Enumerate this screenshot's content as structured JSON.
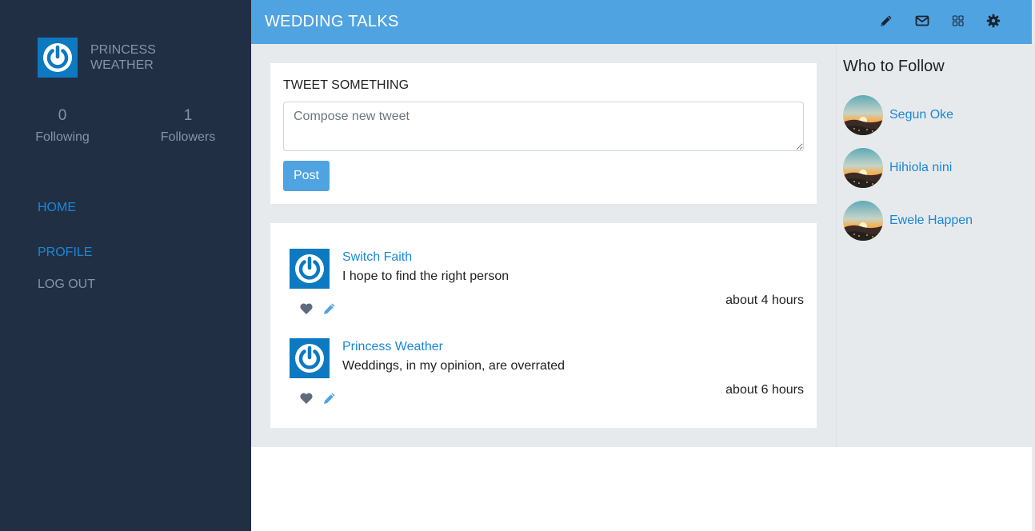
{
  "sidebar": {
    "profile_name": "PRINCESS WEATHER",
    "stats": {
      "following_count": "0",
      "following_label": "Following",
      "followers_count": "1",
      "followers_label": "Followers"
    },
    "nav": {
      "home": "HOME",
      "profile": "PROFILE",
      "logout": "LOG OUT"
    }
  },
  "header": {
    "title": "WEDDING TALKS",
    "icons": [
      "pencil-icon",
      "envelope-icon",
      "grid-icon",
      "gear-icon"
    ]
  },
  "compose": {
    "title": "TWEET SOMETHING",
    "placeholder": "Compose new tweet",
    "value": "",
    "post_label": "Post"
  },
  "feed": [
    {
      "author": "Switch Faith",
      "text": "I hope to find the right person",
      "time": "about 4 hours"
    },
    {
      "author": "Princess Weather",
      "text": "Weddings, in my opinion, are overrated",
      "time": "about 6 hours"
    }
  ],
  "who_to_follow": {
    "title": "Who to Follow",
    "users": [
      {
        "name": "Segun Oke"
      },
      {
        "name": "Hihiola nini"
      },
      {
        "name": "Ewele Happen"
      }
    ]
  },
  "colors": {
    "sidebar_bg": "#212f45",
    "topbar_bg": "#50a3e1",
    "link": "#1a87d6",
    "muted": "#8793a4",
    "avatar_bg": "#0d79c1",
    "content_bg": "#e7eaed"
  }
}
